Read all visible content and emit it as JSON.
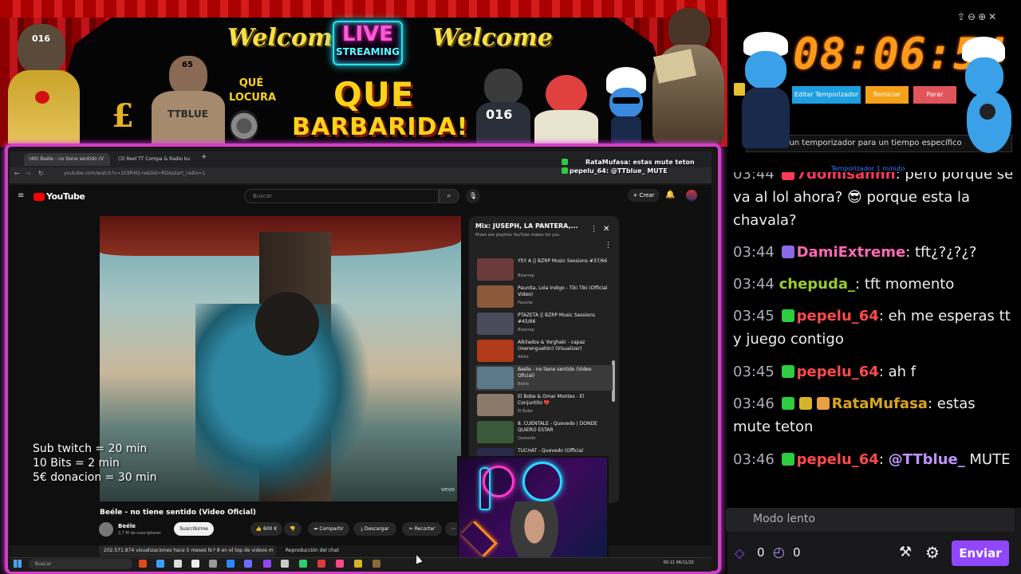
{
  "banner": {
    "welcome_left": "Welcome",
    "welcome_right": "Welcome",
    "live_line1": "LIVE",
    "live_line2": "STREAMING",
    "que": "QUE",
    "barbarida": "BARBARIDA!",
    "que_locura": "QUÉ LOCURA",
    "cat_number": "016",
    "biker_number": "65",
    "biker_shirt": "TTBLUE",
    "cat2_number": "016"
  },
  "browser": {
    "tab1": "(49) Beéle - no tiene sentido (V",
    "tab2": "(3) Reel TT Compa & Radio ku",
    "url": "youtube.com/watch?v=1E9fHiQ-re&list=RD&start_radio=1"
  },
  "stream_alert": {
    "line1": "RataMufasa: estas mute teton",
    "line2": "pepelu_64: @TTblue_ MUTE"
  },
  "youtube": {
    "logo": "YouTube",
    "search_placeholder": "Buscar",
    "create": "+ Crear",
    "video_title": "Beéle - no tiene sentido (Video Oficial)",
    "channel": "Beéle",
    "subscribers": "2,7 M de suscriptores",
    "subscribe": "Suscribirme",
    "likes": "600 K",
    "share": "Compartir",
    "download": "Descargar",
    "clip": "Recortar",
    "description": "202.571.874 visualizaciones hace 5 meses  N.º 8 en el top de videos m",
    "chat_replay": "Reproducción del chat",
    "vevo": "vevo",
    "overlay": [
      "Sub twitch = 20 min",
      "10 Bits = 2 min",
      "5€ donacion = 30 min"
    ]
  },
  "playlist": {
    "title": "Mix: JUSEPH, LA PANTERA,...",
    "subtitle": "Mixes are playlists YouTube makes for you",
    "items": [
      {
        "title": "YSY A || BZRP Music Sessions #37/66",
        "channel": "Bizarrap",
        "color": "#6b3b3b"
      },
      {
        "title": "Paunita, Lola Indigo - Tiki Tiki (Official Video)",
        "channel": "Paunita",
        "color": "#8a5a3a"
      },
      {
        "title": "PTAZETA || BZRP Music Sessions #45/66",
        "channel": "Bizarrap",
        "color": "#4a4a5a"
      },
      {
        "title": "Alkilados & Yorghaki - capaz (merenguetón) (Visualizer)",
        "channel": "Alkilo",
        "color": "#b03a1a"
      },
      {
        "title": "Beéle - no tiene sentido (Video Oficial)",
        "channel": "Beéle",
        "color": "#5a7a8a"
      },
      {
        "title": "El Bobe & Omar Montes - El Conjuntito 💔",
        "channel": "El Bobe",
        "color": "#8a7a6a"
      },
      {
        "title": "8. CUENTALE - Quevedo | DONDE QUIERO ESTAR",
        "channel": "Quevedo",
        "color": "#3a5a3a"
      },
      {
        "title": "TUCHAT - Quevedo (Official",
        "channel": "Quevedo",
        "color": "#2a2a4a"
      }
    ]
  },
  "taskbar": {
    "search": "Buscar",
    "time": "00:11 06/11/25"
  },
  "timer": {
    "digits": "08:06:54",
    "edit": "Editar Temporizador",
    "reset": "Reiniciar",
    "stop": "Parar",
    "input": "er un temporizador para un tiempo específico",
    "label": "Temporizador 1 minuto"
  },
  "chat": {
    "messages": [
      {
        "time": "03:44",
        "user": "7domisahhh",
        "color": "#ff3a5a",
        "text": ": pero porque se va al lol ahora? 😎 porque esta la chavala?"
      },
      {
        "time": "03:44",
        "user": "DamiExtreme",
        "color": "#ff69b4",
        "text": ": tft¿?¿?¿?"
      },
      {
        "time": "03:44",
        "user": "chepuda_",
        "color": "#9acd32",
        "text": ": tft momento"
      },
      {
        "time": "03:45",
        "user": "pepelu_64",
        "color": "#ff4a4a",
        "text": ": eh me esperas tt y juego contigo"
      },
      {
        "time": "03:45",
        "user": "pepelu_64",
        "color": "#ff4a4a",
        "text": ": ah f"
      },
      {
        "time": "03:46",
        "user": "RataMufasa",
        "color": "#daa520",
        "text": ": estas mute teton"
      },
      {
        "time": "03:46",
        "user": "pepelu_64",
        "color": "#ff4a4a",
        "text": ": ",
        "mention": "@TTblue_",
        "after": " MUTE"
      }
    ],
    "slow_mode": "Modo lento",
    "points_a": "0",
    "points_b": "0",
    "send": "Enviar"
  },
  "colors": {
    "accent_border": "#d63cc7",
    "timer": "#ff9a1a",
    "twitch_purple": "#9147ff"
  }
}
